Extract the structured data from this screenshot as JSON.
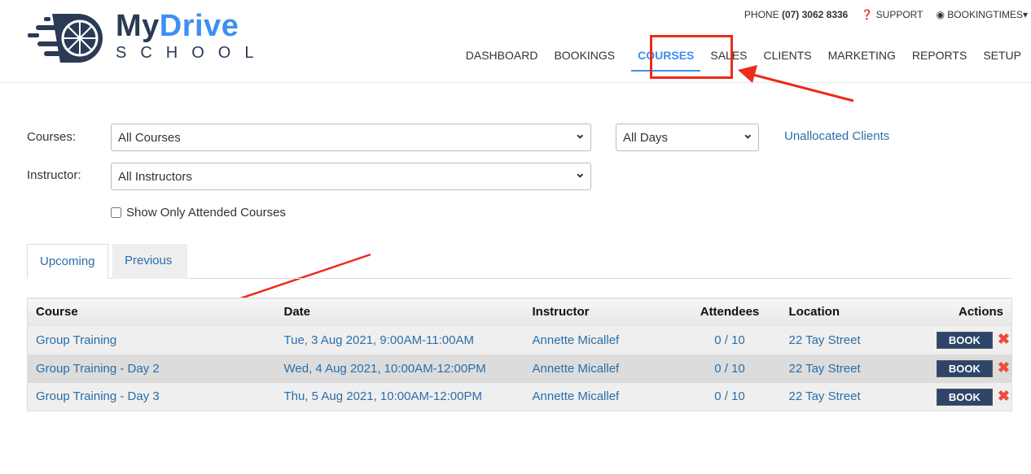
{
  "brand": {
    "line1a": "My",
    "line1b": "Drive",
    "line2": "SCHOOL"
  },
  "topbar": {
    "phone_label": "PHONE",
    "phone": "(07) 3062 8336",
    "support": "SUPPORT",
    "account": "BOOKINGTIMES"
  },
  "nav": [
    "DASHBOARD",
    "BOOKINGS",
    "COURSES",
    "SALES",
    "CLIENTS",
    "MARKETING",
    "REPORTS",
    "SETUP"
  ],
  "filters": {
    "courses_label": "Courses:",
    "courses_value": "All Courses",
    "days_value": "All Days",
    "unallocated": "Unallocated Clients",
    "instructor_label": "Instructor:",
    "instructor_value": "All Instructors",
    "attended_label": "Show Only Attended Courses"
  },
  "tabs": [
    "Upcoming",
    "Previous"
  ],
  "table": {
    "headers": [
      "Course",
      "Date",
      "Instructor",
      "Attendees",
      "Location",
      "Actions"
    ],
    "rows": [
      {
        "course": "Group Training",
        "date": "Tue, 3 Aug 2021, 9:00AM-11:00AM",
        "instructor": "Annette Micallef",
        "attendees": "0 / 10",
        "location": "22 Tay Street",
        "action": "BOOK"
      },
      {
        "course": "Group Training - Day 2",
        "date": "Wed, 4 Aug 2021, 10:00AM-12:00PM",
        "instructor": "Annette Micallef",
        "attendees": "0 / 10",
        "location": "22 Tay Street",
        "action": "BOOK"
      },
      {
        "course": "Group Training - Day 3",
        "date": "Thu, 5 Aug 2021, 10:00AM-12:00PM",
        "instructor": "Annette Micallef",
        "attendees": "0 / 10",
        "location": "22 Tay Street",
        "action": "BOOK"
      }
    ]
  },
  "colors": {
    "accent": "#3f8ff0",
    "brand_dark": "#2b3a55",
    "annotation": "#ee2a1a"
  }
}
